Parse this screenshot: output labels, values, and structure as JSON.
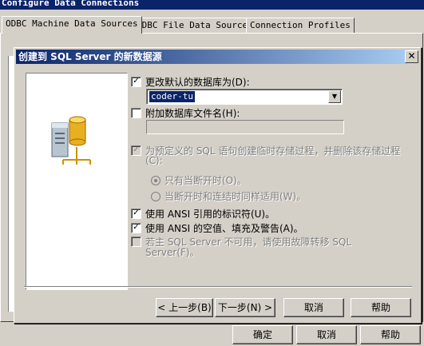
{
  "outer_window": {
    "title": "Configure Data Connections",
    "tabs": [
      {
        "label": "ODBC Machine Data Sources"
      },
      {
        "label": "ODBC File Data Sources"
      },
      {
        "label": "Connection Profiles"
      }
    ],
    "buttons": {
      "ok": "确定",
      "cancel": "取消",
      "help": "帮助"
    }
  },
  "dialog": {
    "title": "创建到 SQL Server 的新数据源",
    "close_glyph": "✕",
    "change_default_db": {
      "label": "更改默认的数据库为(D):",
      "checked": true
    },
    "database_combo": {
      "value": "coder-tu"
    },
    "attach_db_file": {
      "label": "附加数据库文件名(H):",
      "checked": false
    },
    "temp_proc": {
      "label_line1": "为预定义的 SQL 语句创建临时存储过程，并删除该存储过程",
      "label_line2": "(C):",
      "checked": true,
      "enabled": false
    },
    "radio_disconnect": {
      "label": "只有当断开时(O)。",
      "selected": true
    },
    "radio_disconnect_and_connect": {
      "label": "当断开时和连结时同样适用(W)。",
      "selected": false
    },
    "ansi_quoted": {
      "label": "使用 ANSI 引用的标识符(U)。",
      "checked": true
    },
    "ansi_nulls": {
      "label": "使用 ANSI 的空值、填充及警告(A)。",
      "checked": true
    },
    "failover": {
      "label_line1": "若主 SQL Server 不可用，请使用故障转移 SQL",
      "label_line2": "Server(F)。",
      "checked": false
    },
    "buttons": {
      "back": "< 上一步(B)",
      "next": "下一步(N) >",
      "cancel": "取消",
      "help": "帮助"
    }
  }
}
